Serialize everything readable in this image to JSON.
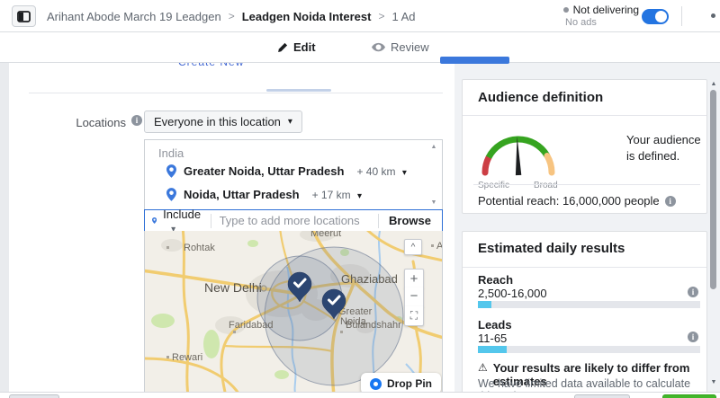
{
  "header": {
    "breadcrumb": [
      "Arihant Abode March 19 Leadgen",
      "Leadgen Noida Interest",
      "1 Ad"
    ],
    "status": {
      "label": "Not delivering",
      "sub": "No ads"
    }
  },
  "tabs": {
    "edit": "Edit",
    "review": "Review"
  },
  "panel": {
    "clipped_link": "Create New",
    "locations_label": "Locations",
    "audience_dropdown": "Everyone in this location",
    "list": {
      "country": "India",
      "items": [
        {
          "name": "Greater Noida, Uttar Pradesh",
          "radius": "+ 40 km"
        },
        {
          "name": "Noida, Uttar Pradesh",
          "radius": "+ 17 km"
        }
      ]
    },
    "include": {
      "label": "Include",
      "placeholder": "Type to add more locations",
      "browse": "Browse"
    },
    "map": {
      "labels": {
        "meerut": "Meerut",
        "rohtak": "Rohtak",
        "new_delhi": "New Delhi",
        "ghaziabad": "Ghaziabad",
        "greater": "Greater",
        "noida": "Noida",
        "faridabad": "Faridabad",
        "bulandshahr": "Bulandshahr",
        "rewari": "Rewari",
        "amroha_clipped": "Am"
      },
      "drop_pin": "Drop Pin"
    }
  },
  "sidebar": {
    "audience_card": {
      "title": "Audience definition",
      "gauge_left": "Specific",
      "gauge_right": "Broad",
      "message": "Your audience is defined.",
      "potential_reach": "Potential reach: 16,000,000 people"
    },
    "results_card": {
      "title": "Estimated daily results",
      "reach_label": "Reach",
      "reach_value": "2,500-16,000",
      "reach_pct": 6,
      "leads_label": "Leads",
      "leads_value": "11-65",
      "leads_pct": 13,
      "warning_title": "Your results are likely to differ from estimates",
      "warning_body": "We have limited data available to calculate this estimate"
    }
  },
  "icons": {
    "caret_down": "▾",
    "chevron": ">",
    "info": "i",
    "plus": "+",
    "minus": "−",
    "recenter": "⛶",
    "collapse": "^",
    "warning": "⚠",
    "bullet": "•",
    "scroll_up": "▲",
    "scroll_down": "▼"
  },
  "colors": {
    "accent_blue": "#1877f2",
    "toggle_blue": "#2374e1",
    "progress_cyan": "#54c7ec",
    "gauge_red": "#cc3e44",
    "gauge_green": "#36a420",
    "gauge_orange": "#f7c481",
    "footer_green": "#42b72a",
    "map_pin_navy": "#2c4672"
  }
}
